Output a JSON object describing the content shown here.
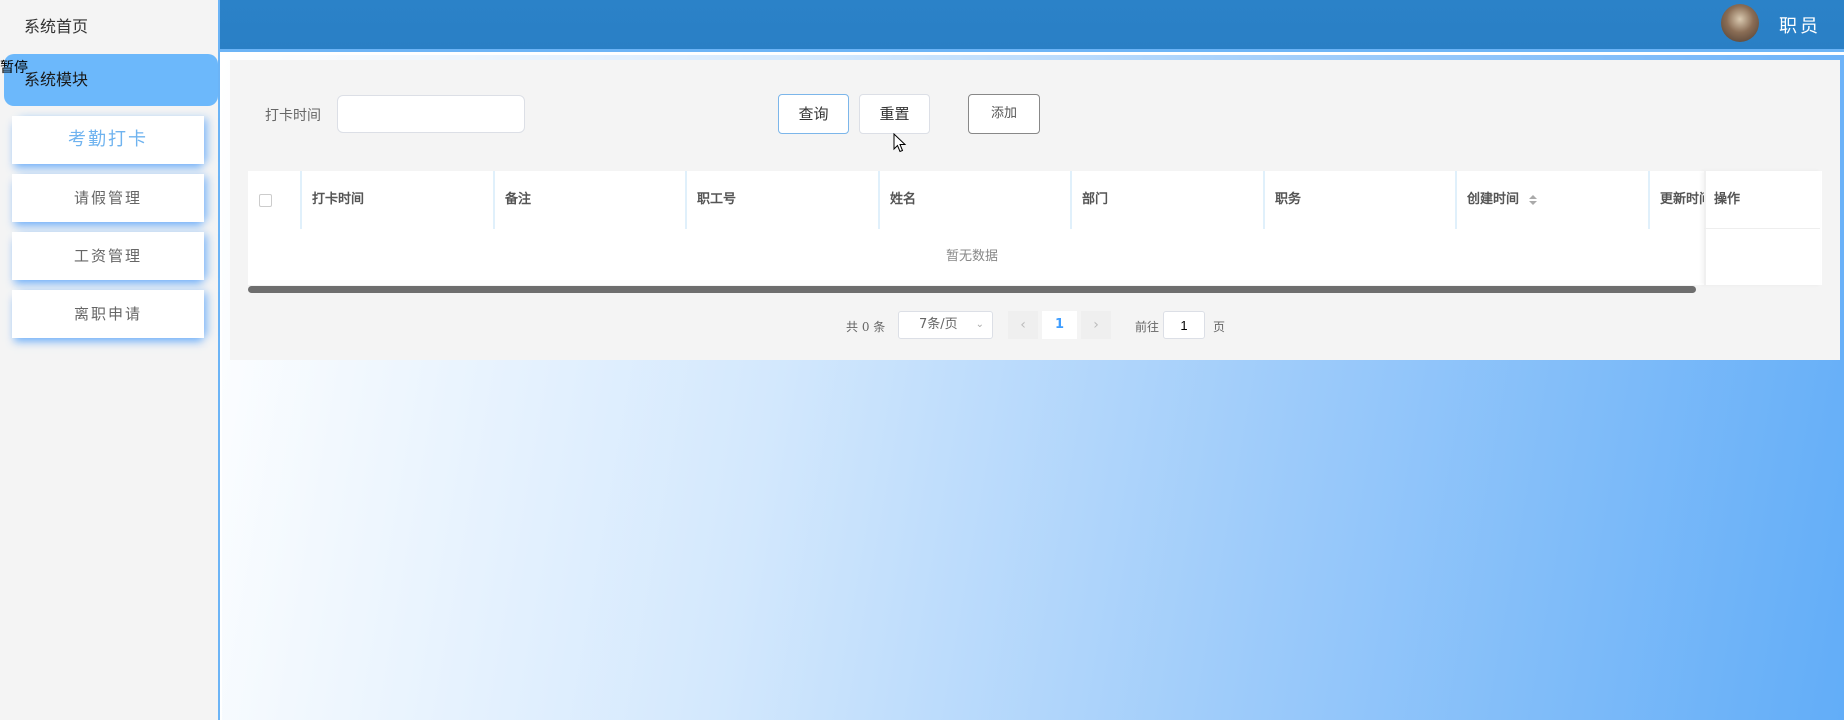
{
  "sidebar": {
    "home": "系统首页",
    "module": "系统模块",
    "overlay_text": "暂停",
    "items": [
      {
        "label": "考勤打卡"
      },
      {
        "label": "请假管理"
      },
      {
        "label": "工资管理"
      },
      {
        "label": "离职申请"
      }
    ]
  },
  "header": {
    "role": "职员",
    "avatar_icon": "user-avatar"
  },
  "search": {
    "label": "打卡时间",
    "value": "",
    "query_label": "查询",
    "reset_label": "重置",
    "add_label": "添加"
  },
  "table": {
    "columns": [
      "打卡时间",
      "备注",
      "职工号",
      "姓名",
      "部门",
      "职务",
      "创建时间",
      "更新时间"
    ],
    "sort_icon": "sort-caret-icon",
    "action_column": "操作",
    "empty_text": "暂无数据"
  },
  "pagination": {
    "total": "共 0 条",
    "page_size": "7条/页",
    "current_page": "1",
    "goto_label": "前往",
    "goto_value": "1",
    "page_suffix": "页"
  },
  "colors": {
    "accent": "#409eff",
    "topbar": "#2a7fc5",
    "active_sidebar": "#6cb8fb"
  }
}
